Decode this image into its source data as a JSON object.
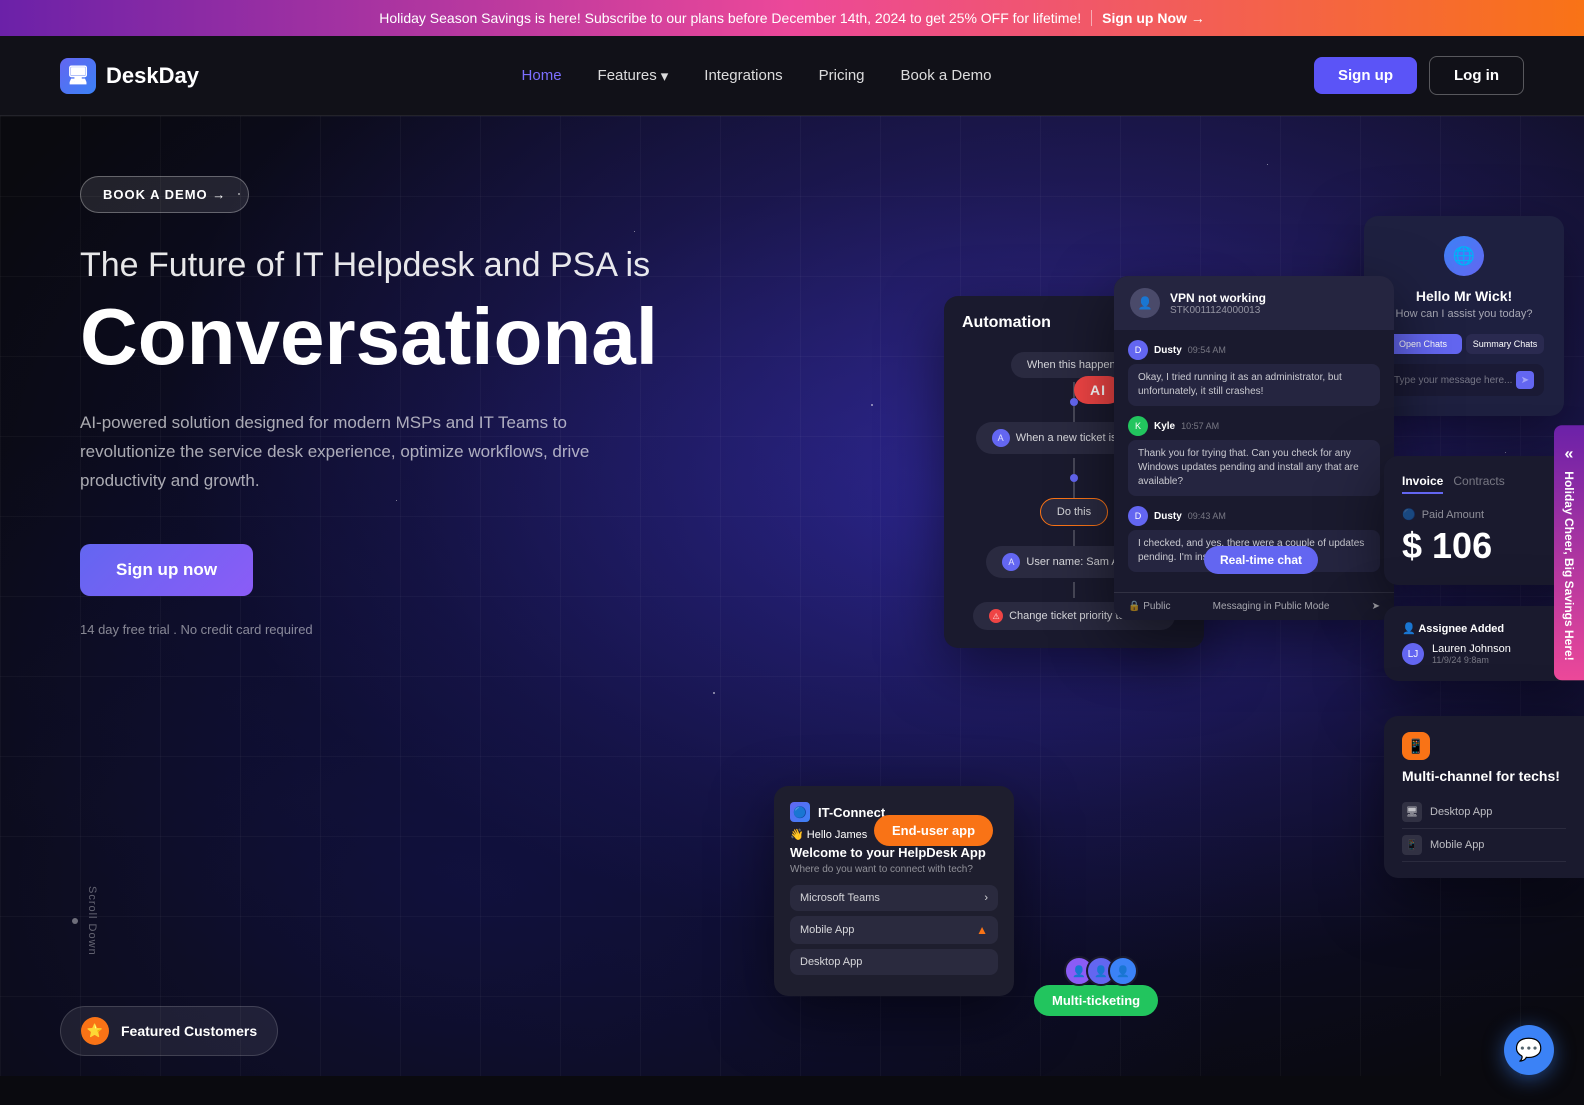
{
  "banner": {
    "text": "Holiday Season Savings is here! Subscribe to our plans before December 14th, 2024 to get 25% OFF for lifetime!",
    "cta": "Sign up Now →"
  },
  "navbar": {
    "logo_text": "DeskDay",
    "links": [
      {
        "label": "Home",
        "active": true
      },
      {
        "label": "Features",
        "has_dropdown": true
      },
      {
        "label": "Integrations",
        "active": false
      },
      {
        "label": "Pricing",
        "active": false
      },
      {
        "label": "Book a Demo",
        "active": false
      }
    ],
    "signup_label": "Sign up",
    "login_label": "Log in"
  },
  "hero": {
    "book_demo_label": "BOOK A DEMO →",
    "subtitle": "The Future of IT Helpdesk and PSA is",
    "title": "Conversational",
    "description": "AI-powered solution designed for modern MSPs and IT Teams to revolutionize the service desk experience, optimize workflows, drive productivity and growth.",
    "cta_label": "Sign up now",
    "trial_text": "14 day free trial . No credit card required",
    "scroll_label": "Scroll Down"
  },
  "mockups": {
    "itconnect": {
      "name": "IT-Connect",
      "hello": "👋 Hello James",
      "welcome": "Welcome to your HelpDesk App",
      "where": "Where do you want to connect with tech?",
      "options": [
        "Microsoft Teams",
        "Mobile App",
        "Desktop App"
      ]
    },
    "badge_enduser": "End-user app",
    "automation": {
      "title": "Automation",
      "steps": [
        "When this happens",
        "When a new ticket is created",
        "Do this",
        "User name: Sam Altman",
        "Change ticket priority to critical"
      ]
    },
    "badge_multiticketing": "Multi-ticketing",
    "hello_wick": {
      "title": "Hello Mr Wick!",
      "subtitle": "How can I assist you today?",
      "tabs": [
        "Open Chats",
        "Summary Chats"
      ],
      "input_placeholder": "Type your message here..."
    },
    "badge_ai": "AI",
    "chat": {
      "ticket_id": "STK0011124000013",
      "ticket_title": "VPN not working",
      "messages": [
        {
          "name": "Dusty",
          "time": "09:54 AM",
          "text": "Okay, I tried running it as an administrator, but unfortunately, it still crashes!"
        },
        {
          "name": "Kyle",
          "time": "10:57 AM",
          "text": "Thank you for trying that. Can you check for any Windows updates pending and install any that are available?"
        },
        {
          "name": "Dusty",
          "time": "09:43 AM",
          "text": "I checked, and yes, there were a couple of updates pending. I'm installing them now."
        }
      ],
      "public_label": "🔒 Public",
      "mode_label": "Messaging in Public Mode"
    },
    "badge_realtime": "Real-time chat",
    "invoice": {
      "tabs": [
        "Invoice",
        "Contracts"
      ],
      "label": "Paid Amount",
      "amount": "$ 106"
    },
    "assignee": {
      "label": "Assignee Added",
      "name": "Lauren Johnson",
      "date": "11/9/24  9:8am"
    },
    "multichannel": {
      "title": "Multi-channel for techs!",
      "options": [
        "Desktop App",
        "Mobile App"
      ]
    }
  },
  "holiday_sidebar": {
    "text": "Holiday Cheer, Big Savings Here!"
  },
  "featured_customers": {
    "label": "Featured Customers"
  },
  "chat_fab": {
    "icon": "💬"
  }
}
